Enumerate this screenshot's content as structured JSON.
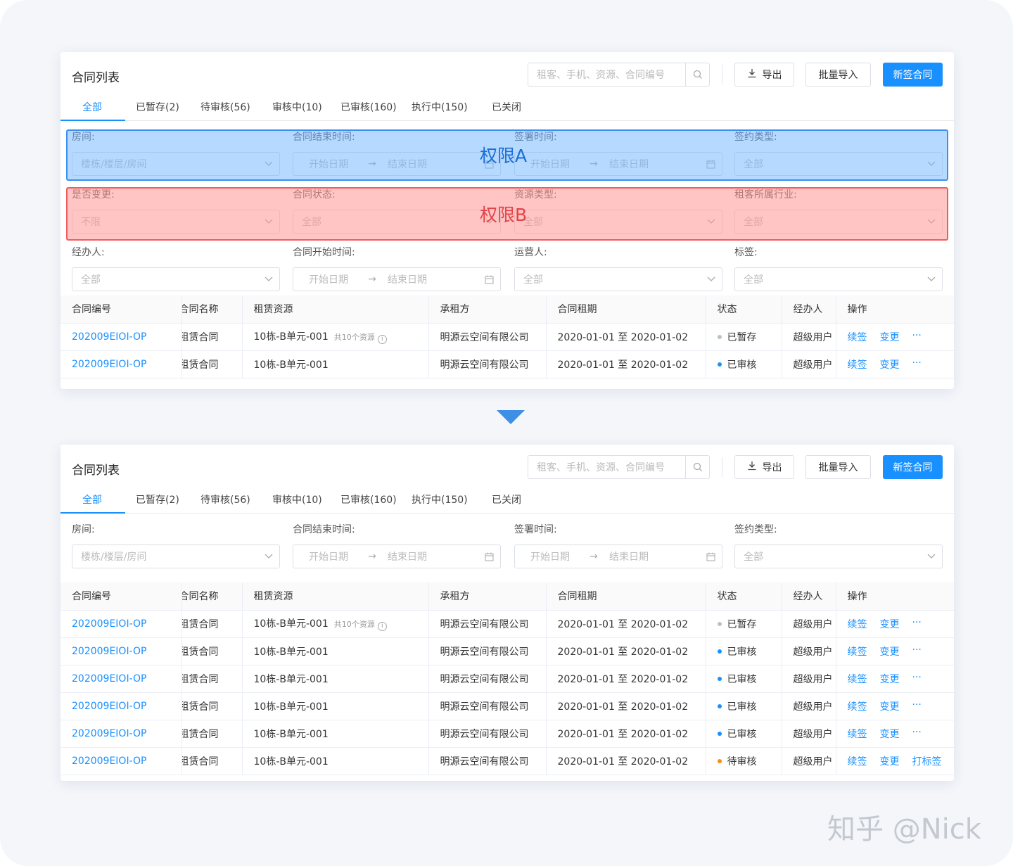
{
  "colors": {
    "primary": "#1890ff",
    "permA": "#3b8ff0",
    "permB": "#ef5c60",
    "status_draft": "#bfbfbf",
    "status_approved": "#1890ff",
    "status_pending": "#fa8c16"
  },
  "page": {
    "title": "合同列表",
    "search_placeholder": "租客、手机、资源、合同编号",
    "export_label": "导出",
    "import_label": "批量导入",
    "new_label": "新签合同",
    "tabs": [
      "全部",
      "已暂存(2)",
      "待审核(56)",
      "审核中(10)",
      "已审核(160)",
      "执行中(150)",
      "已关闭"
    ]
  },
  "filters": {
    "room_label": "房间:",
    "room_ph": "楼栋/楼层/房间",
    "end_label": "合同结束时间:",
    "sign_label": "签署时间:",
    "sign_type_label": "签约类型:",
    "change_label": "是否变更:",
    "change_val": "不限",
    "status_label": "合同状态:",
    "res_type_label": "资源类型:",
    "industry_label": "租客所属行业:",
    "agent_label": "经办人:",
    "start_label": "合同开始时间:",
    "operator_label": "运营人:",
    "tag_label": "标签:",
    "all": "全部",
    "date_start": "开始日期",
    "date_end": "结束日期",
    "arrow": "→"
  },
  "perms": {
    "a": "权限A",
    "b": "权限B"
  },
  "table": {
    "headers": [
      "合同编号",
      "合同名称",
      "租赁资源",
      "承租方",
      "合同租期",
      "状态",
      "经办人",
      "操作"
    ],
    "resource_note": "共10个资源",
    "actions": {
      "renew": "续签",
      "change": "变更",
      "more": "···",
      "tag": "打标签"
    },
    "rows1": [
      {
        "no": "202009EIOI-OP",
        "name": "租赁合同",
        "res": "10栋-B单元-001",
        "note": true,
        "tenant": "明源云空间有限公司",
        "term": "2020-01-01 至 2020-01-02",
        "status": "已暂存",
        "kind": "draft",
        "agent": "超级用户"
      },
      {
        "no": "202009EIOI-OP",
        "name": "租赁合同",
        "res": "10栋-B单元-001",
        "note": false,
        "tenant": "明源云空间有限公司",
        "term": "2020-01-01 至 2020-01-02",
        "status": "已审核",
        "kind": "approved",
        "agent": "超级用户"
      }
    ],
    "rows2": [
      {
        "no": "202009EIOI-OP",
        "name": "租赁合同",
        "res": "10栋-B单元-001",
        "note": true,
        "tenant": "明源云空间有限公司",
        "term": "2020-01-01 至 2020-01-02",
        "status": "已暂存",
        "kind": "draft",
        "agent": "超级用户"
      },
      {
        "no": "202009EIOI-OP",
        "name": "租赁合同",
        "res": "10栋-B单元-001",
        "note": false,
        "tenant": "明源云空间有限公司",
        "term": "2020-01-01 至 2020-01-02",
        "status": "已审核",
        "kind": "approved",
        "agent": "超级用户"
      },
      {
        "no": "202009EIOI-OP",
        "name": "租赁合同",
        "res": "10栋-B单元-001",
        "note": false,
        "tenant": "明源云空间有限公司",
        "term": "2020-01-01 至 2020-01-02",
        "status": "已审核",
        "kind": "approved",
        "agent": "超级用户"
      },
      {
        "no": "202009EIOI-OP",
        "name": "租赁合同",
        "res": "10栋-B单元-001",
        "note": false,
        "tenant": "明源云空间有限公司",
        "term": "2020-01-01 至 2020-01-02",
        "status": "已审核",
        "kind": "approved",
        "agent": "超级用户"
      },
      {
        "no": "202009EIOI-OP",
        "name": "租赁合同",
        "res": "10栋-B单元-001",
        "note": false,
        "tenant": "明源云空间有限公司",
        "term": "2020-01-01 至 2020-01-02",
        "status": "已审核",
        "kind": "approved",
        "agent": "超级用户"
      },
      {
        "no": "202009EIOI-OP",
        "name": "租赁合同",
        "res": "10栋-B单元-001",
        "note": false,
        "tenant": "明源云空间有限公司",
        "term": "2020-01-01 至 2020-01-02",
        "status": "待审核",
        "kind": "pending",
        "agent": "超级用户",
        "tag": true
      }
    ]
  },
  "watermark": "知乎 @Nick"
}
